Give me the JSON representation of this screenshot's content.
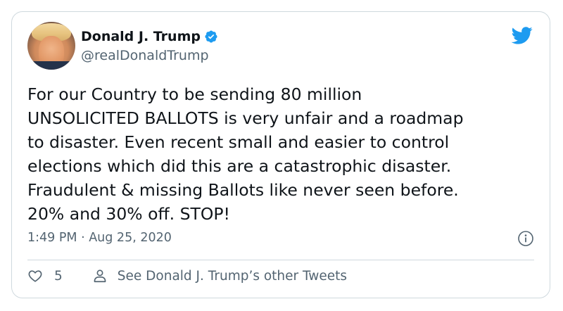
{
  "tweet": {
    "author": {
      "display_name": "Donald J. Trump",
      "handle": "@realDonaldTrump",
      "verified": true
    },
    "text": "For our Country to be sending 80 million\nUNSOLICITED BALLOTS is very unfair and a roadmap\nto disaster. Even recent small and easier to control\nelections which did this are a catastrophic disaster.\nFraudulent & missing Ballots like never seen before.\n20% and 30% off. STOP!",
    "timestamp": "1:49 PM · Aug 25, 2020",
    "likes_count": "5",
    "see_more_label": "See Donald J. Trump’s other Tweets"
  },
  "icons": {
    "brand": "twitter-bird-icon",
    "verified": "verified-badge-icon",
    "info": "info-icon",
    "like": "heart-icon",
    "profile": "person-icon"
  },
  "colors": {
    "brand_blue": "#1d9bf0",
    "text": "#0f1419",
    "secondary_text": "#536471",
    "border": "#cfd9de",
    "background": "#ffffff"
  }
}
